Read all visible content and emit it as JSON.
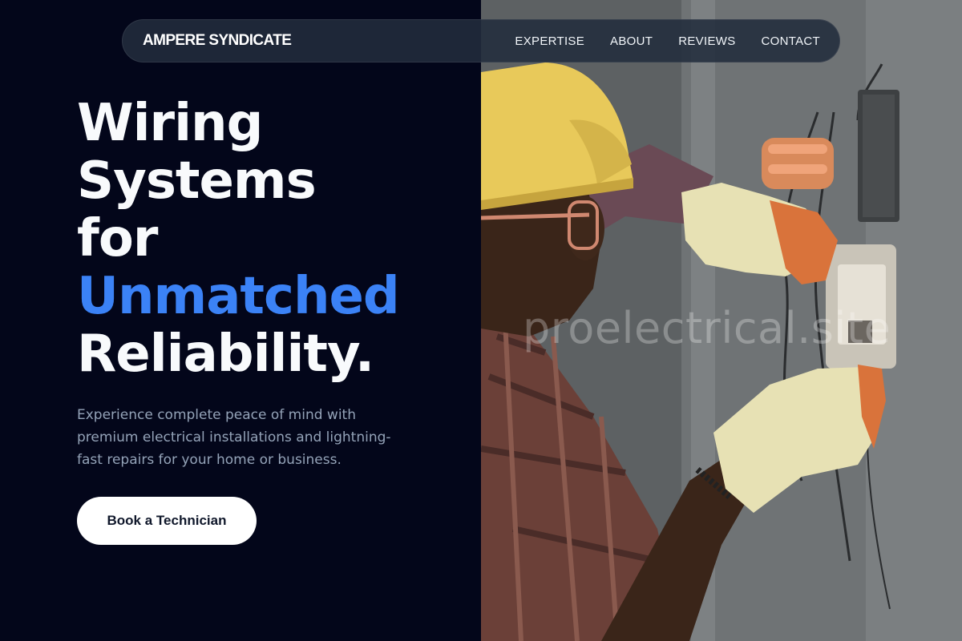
{
  "nav": {
    "brand": "AMPERE SYNDICATE",
    "links": [
      "EXPERTISE",
      "ABOUT",
      "REVIEWS",
      "CONTACT"
    ]
  },
  "hero": {
    "title_lines": [
      "Wiring",
      "Systems",
      "for"
    ],
    "title_accent": "Unmatched",
    "title_end": "Reliability.",
    "subtitle": "Experience complete peace of mind with premium electrical installations and lightning-fast repairs for your home or business.",
    "cta_label": "Book a Technician"
  },
  "photo": {
    "watermark": "proelectrical.site"
  },
  "colors": {
    "background": "#03061a",
    "accent": "#3b82f6",
    "nav_bg": "#222c3c",
    "button_bg": "#ffffff"
  }
}
